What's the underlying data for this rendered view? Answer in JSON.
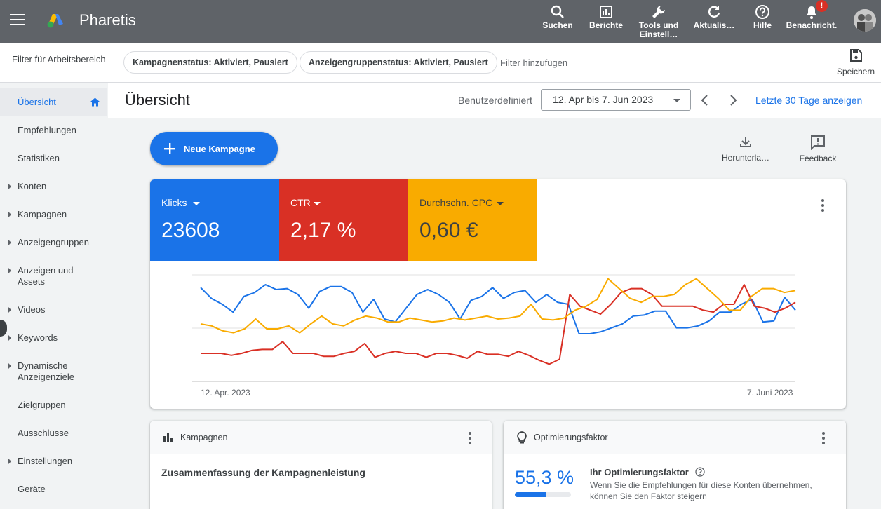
{
  "app": {
    "name": "Pharetis"
  },
  "topbar": {
    "actions": [
      {
        "label": "Suchen",
        "icon": "search-icon"
      },
      {
        "label": "Berichte",
        "icon": "reports-icon"
      },
      {
        "label": "Tools und Einstell…",
        "icon": "wrench-icon"
      },
      {
        "label": "Aktualis…",
        "icon": "refresh-icon"
      },
      {
        "label": "Hilfe",
        "icon": "help-icon"
      },
      {
        "label": "Benachricht.",
        "icon": "bell-icon",
        "badge": "!"
      }
    ]
  },
  "filterbar": {
    "label": "Filter für Arbeitsbereich",
    "chips": [
      "Kampagnenstatus: Aktiviert, Pausiert",
      "Anzeigengruppenstatus: Aktiviert, Pausiert"
    ],
    "add_filter": "Filter hinzufügen",
    "save_label": "Speichern"
  },
  "sidebar": {
    "items": [
      {
        "label": "Übersicht",
        "active": true
      },
      {
        "label": "Empfehlungen"
      },
      {
        "label": "Statistiken"
      },
      {
        "label": "Konten",
        "expandable": true
      },
      {
        "label": "Kampagnen",
        "expandable": true
      },
      {
        "label": "Anzeigengruppen",
        "expandable": true
      },
      {
        "label": "Anzeigen und Assets",
        "expandable": true
      },
      {
        "label": "Videos",
        "expandable": true
      },
      {
        "label": "Keywords",
        "expandable": true
      },
      {
        "label": "Dynamische Anzeigenziele",
        "expandable": true
      },
      {
        "label": "Zielgruppen"
      },
      {
        "label": "Ausschlüsse"
      },
      {
        "label": "Einstellungen",
        "expandable": true
      },
      {
        "label": "Geräte"
      }
    ]
  },
  "header": {
    "title": "Übersicht",
    "date_mode": "Benutzerdefiniert",
    "date_range": "12. Apr bis 7. Jun 2023",
    "last30": "Letzte 30 Tage anzeigen"
  },
  "toolbar": {
    "new_campaign": "Neue Kampagne",
    "download": "Herunterla…",
    "feedback": "Feedback"
  },
  "metrics": [
    {
      "name": "Klicks",
      "value": "23608",
      "color": "#1a73e8"
    },
    {
      "name": "CTR",
      "value": "2,17 %",
      "color": "#d93025"
    },
    {
      "name": "Durchschn. CPC",
      "value": "0,60 €",
      "color": "#f9ab00"
    }
  ],
  "chart_data": {
    "type": "line",
    "x_start_label": "12. Apr. 2023",
    "x_end_label": "7. Juni 2023",
    "series": [
      {
        "name": "Klicks",
        "color": "#1a73e8",
        "values": [
          0.87,
          0.76,
          0.7,
          0.62,
          0.78,
          0.82,
          0.9,
          0.85,
          0.86,
          0.8,
          0.66,
          0.83,
          0.88,
          0.88,
          0.82,
          0.62,
          0.75,
          0.55,
          0.52,
          0.66,
          0.8,
          0.85,
          0.8,
          0.72,
          0.55,
          0.74,
          0.78,
          0.87,
          0.76,
          0.82,
          0.84,
          0.72,
          0.8,
          0.72,
          0.7,
          0.4,
          0.4,
          0.42,
          0.46,
          0.5,
          0.58,
          0.59,
          0.63,
          0.63,
          0.46,
          0.46,
          0.48,
          0.53,
          0.62,
          0.62,
          0.7,
          0.75,
          0.52,
          0.53,
          0.77,
          0.64
        ]
      },
      {
        "name": "CTR",
        "color": "#d93025",
        "values": [
          0.2,
          0.2,
          0.2,
          0.18,
          0.2,
          0.23,
          0.24,
          0.24,
          0.32,
          0.2,
          0.2,
          0.2,
          0.17,
          0.17,
          0.2,
          0.22,
          0.3,
          0.16,
          0.2,
          0.22,
          0.2,
          0.2,
          0.16,
          0.2,
          0.2,
          0.18,
          0.15,
          0.22,
          0.19,
          0.19,
          0.17,
          0.22,
          0.18,
          0.13,
          0.09,
          0.14,
          0.8,
          0.68,
          0.64,
          0.6,
          0.7,
          0.82,
          0.86,
          0.86,
          0.8,
          0.68,
          0.68,
          0.68,
          0.68,
          0.64,
          0.62,
          0.7,
          0.7,
          0.9,
          0.68,
          0.66,
          0.62,
          0.66,
          0.72
        ]
      },
      {
        "name": "Durchschn. CPC",
        "color": "#f9ab00",
        "values": [
          0.5,
          0.48,
          0.43,
          0.41,
          0.45,
          0.55,
          0.45,
          0.45,
          0.48,
          0.41,
          0.5,
          0.58,
          0.5,
          0.48,
          0.54,
          0.58,
          0.56,
          0.52,
          0.52,
          0.56,
          0.54,
          0.52,
          0.53,
          0.56,
          0.54,
          0.56,
          0.58,
          0.55,
          0.56,
          0.58,
          0.7,
          0.55,
          0.54,
          0.56,
          0.64,
          0.68,
          0.75,
          0.96,
          0.86,
          0.76,
          0.72,
          0.78,
          0.78,
          0.8,
          0.9,
          0.96,
          0.86,
          0.76,
          0.64,
          0.64,
          0.78,
          0.86,
          0.86,
          0.82,
          0.84
        ]
      }
    ]
  },
  "cards": {
    "campaigns": {
      "title": "Kampagnen",
      "subtitle": "Zusammenfassung der Kampagnenleistung"
    },
    "optimization": {
      "title": "Optimierungsfaktor",
      "value": "55,3 %",
      "progress": 0.553,
      "heading": "Ihr Optimierungsfaktor",
      "text": "Wenn Sie die Empfehlungen für diese Konten übernehmen, können Sie den Faktor steigern"
    }
  }
}
